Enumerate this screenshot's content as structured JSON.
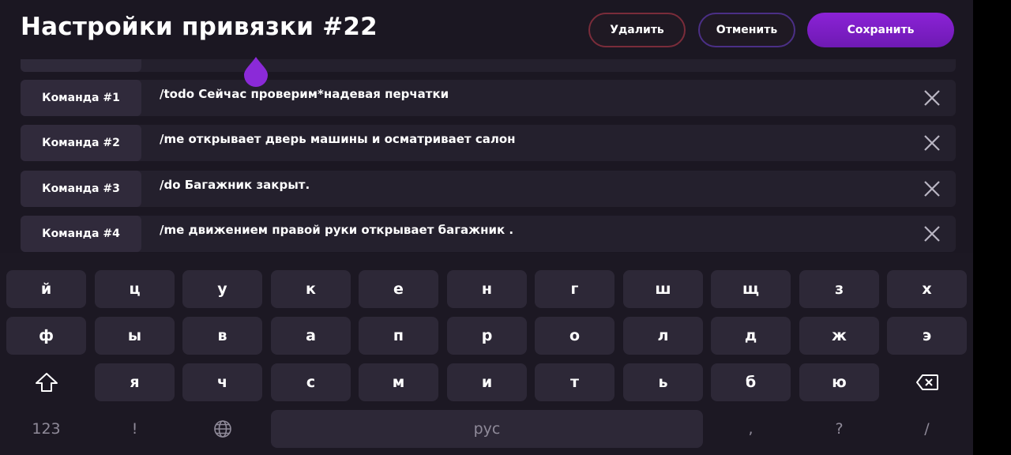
{
  "header": {
    "title": "Настройки привязки #22",
    "delete_label": "Удалить",
    "cancel_label": "Отменить",
    "save_label": "Сохранить"
  },
  "commands": [
    {
      "label": "Команда #1",
      "text": "/todo Сейчас проверим*надевая перчатки"
    },
    {
      "label": "Команда #2",
      "text": "/me открывает дверь машины и осматривает салон"
    },
    {
      "label": "Команда #3",
      "text": "/do Багажник закрыт."
    },
    {
      "label": "Команда #4",
      "text": "/me движением правой руки открывает багажник ."
    }
  ],
  "keyboard": {
    "row1": [
      "й",
      "ц",
      "у",
      "к",
      "е",
      "н",
      "г",
      "ш",
      "щ",
      "з",
      "х"
    ],
    "row2": [
      "ф",
      "ы",
      "в",
      "а",
      "п",
      "р",
      "о",
      "л",
      "д",
      "ж",
      "э"
    ],
    "row3": [
      "я",
      "ч",
      "с",
      "м",
      "и",
      "т",
      "ь",
      "б",
      "ю"
    ],
    "row4": {
      "num": "123",
      "excl": "!",
      "space": "рус",
      "comma": ",",
      "question": "?",
      "slash": "/"
    }
  },
  "icons": {
    "remove": "close-icon",
    "shift": "shift-icon",
    "backspace": "backspace-icon",
    "globe": "globe-icon",
    "cursor": "cursor-handle-icon"
  },
  "colors": {
    "accent": "#8b22d6",
    "delete_border": "#7a2c3a",
    "cancel_border": "#4b2f86"
  }
}
